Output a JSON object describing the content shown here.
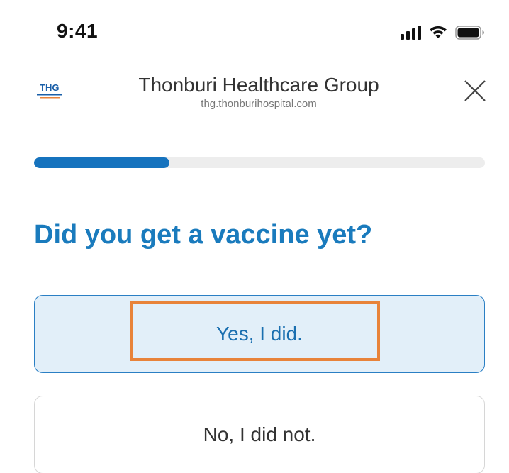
{
  "status_bar": {
    "time": "9:41",
    "signal_icon": "cellular-signal-icon",
    "wifi_icon": "wifi-icon",
    "battery_icon": "battery-icon"
  },
  "header": {
    "logo_text": "THG",
    "title": "Thonburi Healthcare Group",
    "url": "thg.thonburihospital.com",
    "close_icon": "close-icon"
  },
  "progress": {
    "value": 0.3
  },
  "question": "Did you get a vaccine yet?",
  "options": [
    {
      "label": "Yes, I did.",
      "selected": true
    },
    {
      "label": "No, I did not.",
      "selected": false
    }
  ],
  "colors": {
    "accent": "#1a7bbd",
    "progress_fill": "#1673be",
    "selected_bg": "#e2eff9",
    "highlight": "#e8833a"
  }
}
